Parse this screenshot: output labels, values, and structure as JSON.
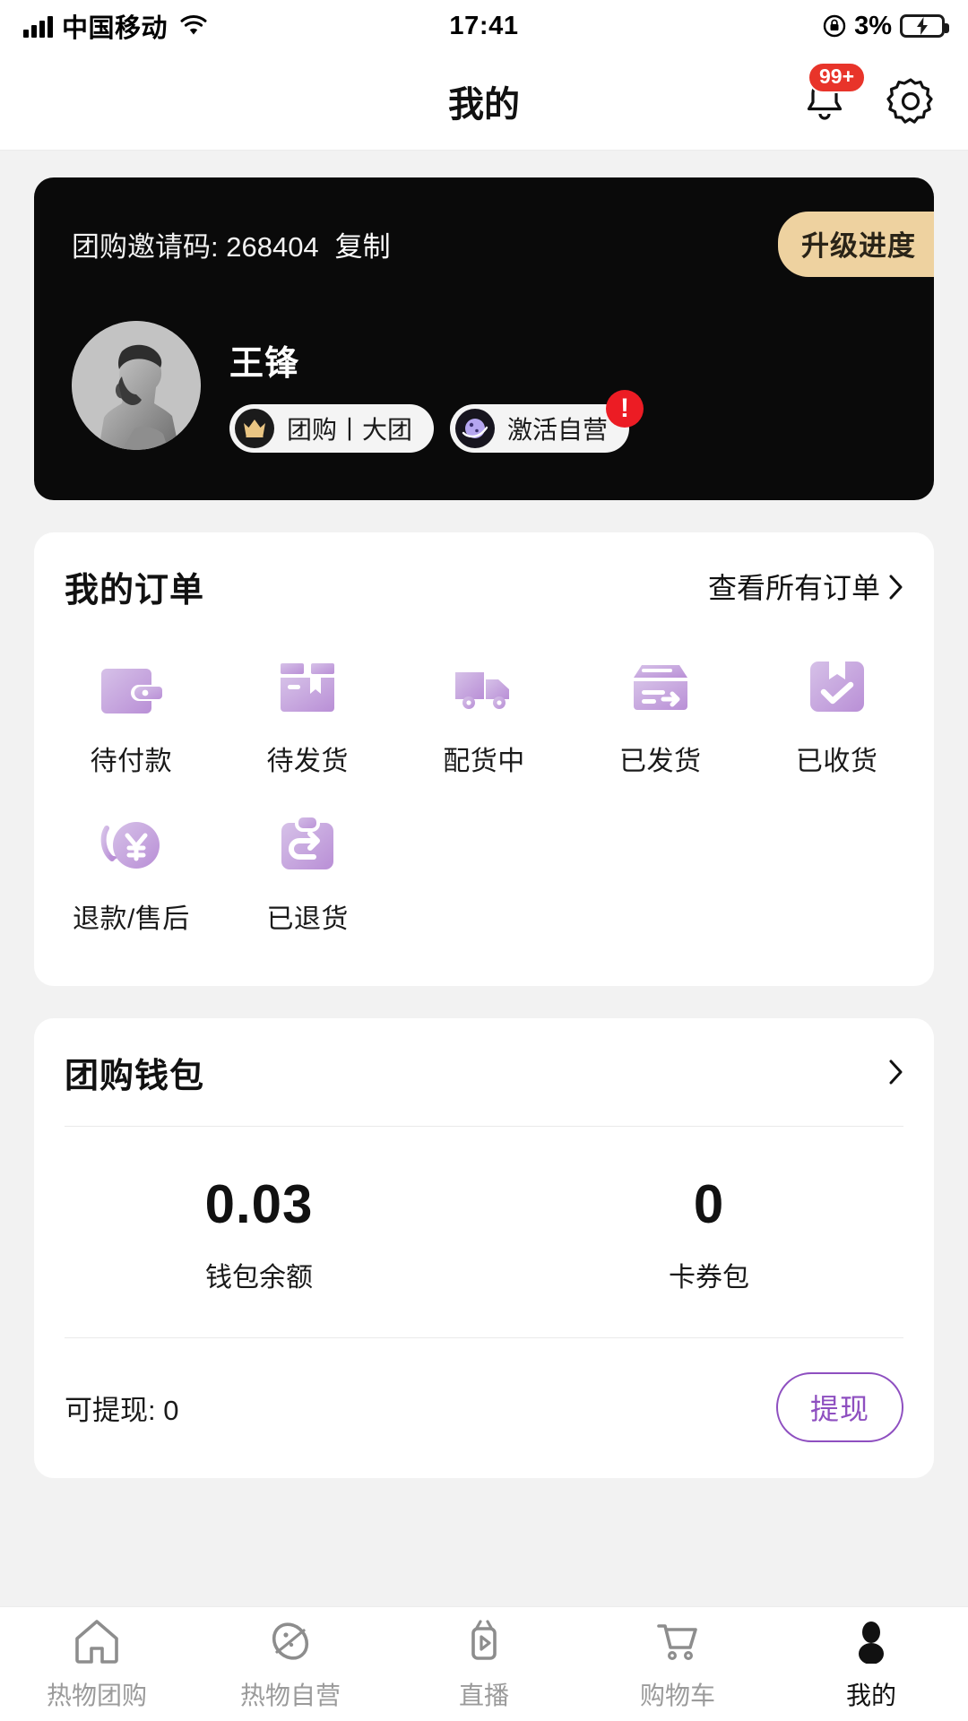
{
  "status_bar": {
    "carrier": "中国移动",
    "time": "17:41",
    "battery_percent": "3%",
    "signal_icon": "signal-bars-icon",
    "wifi_icon": "wifi-icon",
    "lock_icon": "rotation-lock-icon",
    "battery_icon": "battery-charging-icon"
  },
  "nav": {
    "title": "我的",
    "bell_icon": "bell-icon",
    "bell_badge": "99+",
    "settings_icon": "gear-icon"
  },
  "profile": {
    "invite_label": "团购邀请码: 268404",
    "copy_label": "复制",
    "upgrade_label": "升级进度",
    "user_name": "王锋",
    "avatar_icon": "user-avatar-photo",
    "tags": [
      {
        "text": "团购丨大团",
        "icon": "crown-icon",
        "alert": ""
      },
      {
        "text": "激活自营",
        "icon": "planet-icon",
        "alert": "!"
      }
    ]
  },
  "orders": {
    "title": "我的订单",
    "view_all": "查看所有订单",
    "chevron_icon": "chevron-right-icon",
    "items": [
      {
        "label": "待付款",
        "icon": "wallet-icon"
      },
      {
        "label": "待发货",
        "icon": "package-open-icon"
      },
      {
        "label": "配货中",
        "icon": "truck-icon"
      },
      {
        "label": "已发货",
        "icon": "box-arrow-icon"
      },
      {
        "label": "已收货",
        "icon": "box-check-icon"
      },
      {
        "label": "退款/售后",
        "icon": "refund-yuan-icon"
      },
      {
        "label": "已退货",
        "icon": "return-clipboard-icon"
      }
    ]
  },
  "wallet": {
    "title": "团购钱包",
    "chevron_icon": "chevron-right-icon",
    "stats": [
      {
        "value": "0.03",
        "label": "钱包余额"
      },
      {
        "value": "0",
        "label": "卡券包"
      }
    ],
    "withdrawable_label": "可提现: 0",
    "withdraw_button": "提现",
    "accent_color": "#8e4fc0"
  },
  "tabbar": {
    "items": [
      {
        "label": "热物团购",
        "icon": "home-icon",
        "active": false
      },
      {
        "label": "热物自营",
        "icon": "planet-icon",
        "active": false
      },
      {
        "label": "直播",
        "icon": "live-play-icon",
        "active": false
      },
      {
        "label": "购物车",
        "icon": "cart-icon",
        "active": false
      },
      {
        "label": "我的",
        "icon": "person-icon",
        "active": true
      }
    ]
  }
}
